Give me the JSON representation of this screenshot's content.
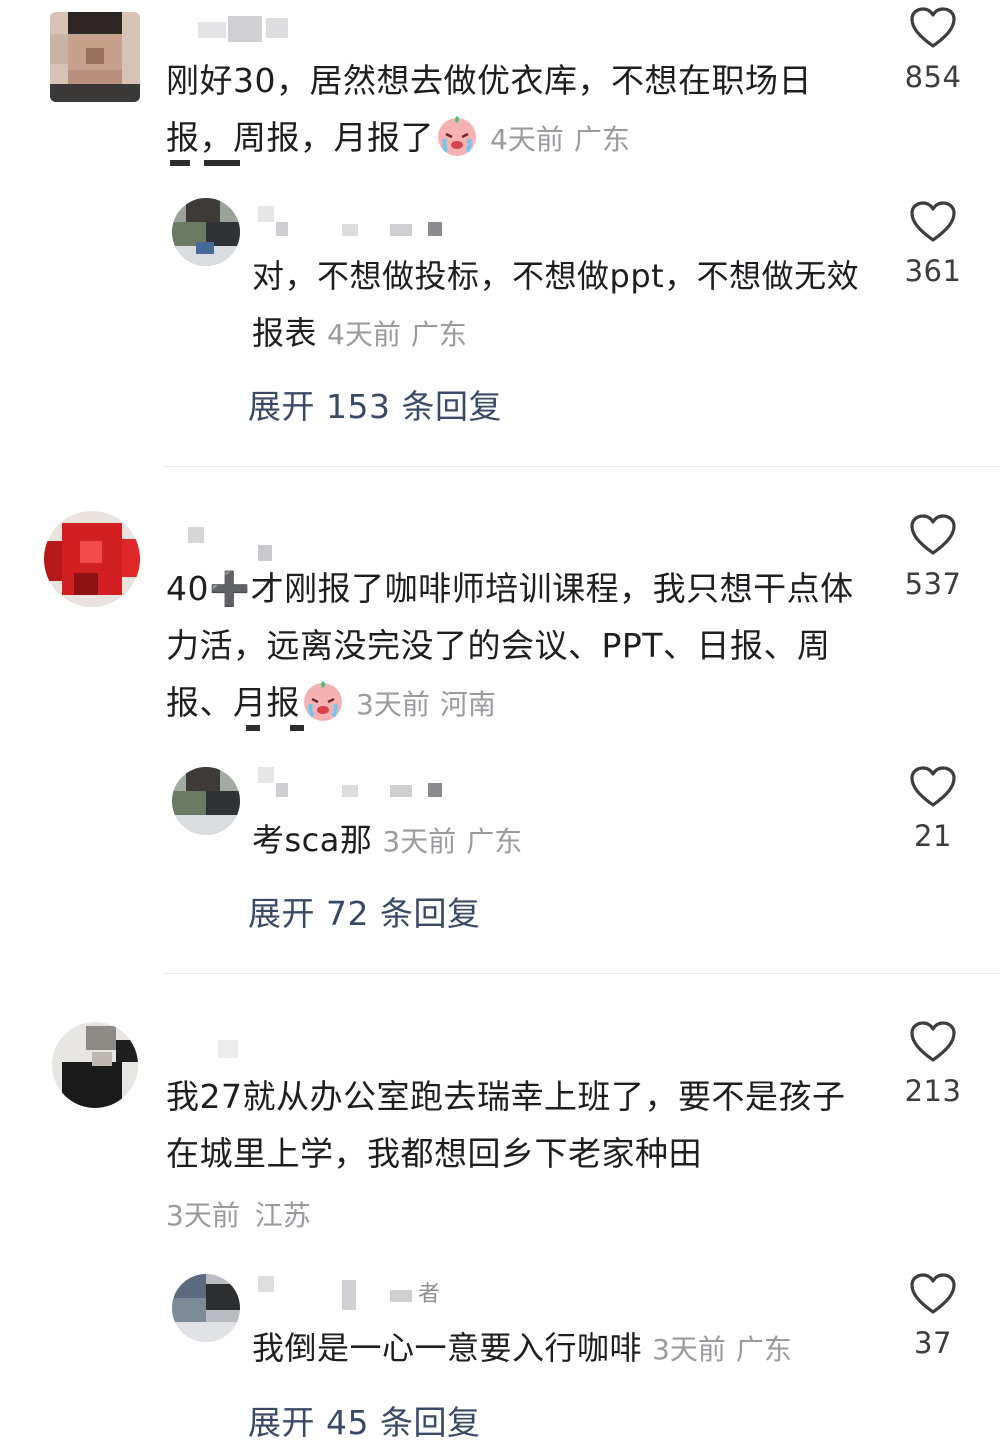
{
  "comments": [
    {
      "text": "刚好30，居然想去做优衣库，不想在职场日报，周报，月报了",
      "time": "4天前",
      "location": "广东",
      "likes": "854",
      "reply": {
        "text": "对，不想做投标，不想做ppt，不想做无效报表",
        "time": "4天前",
        "location": "广东",
        "likes": "361"
      },
      "expand_label": "展开 153 条回复"
    },
    {
      "text": "40➕才刚报了咖啡师培训课程，我只想干点体力活，远离没完没了的会议、PPT、日报、周报、月报",
      "time": "3天前",
      "location": "河南",
      "likes": "537",
      "reply": {
        "text": "考sca那",
        "time": "3天前",
        "location": "广东",
        "likes": "21"
      },
      "expand_label": "展开 72 条回复"
    },
    {
      "text": "我27就从办公室跑去瑞幸上班了，要不是孩子在城里上学，我都想回乡下老家种田",
      "time": "3天前",
      "location": "江苏",
      "likes": "213",
      "reply": {
        "nickname_visible": "者",
        "text": "我倒是一心一意要入行咖啡",
        "time": "3天前",
        "location": "广东",
        "likes": "37"
      },
      "expand_label": "展开 45 条回复"
    }
  ],
  "icons": {
    "like": "heart-outline-icon",
    "emoji": "crying-face-emoji-icon",
    "plus": "heavy-plus-icon"
  },
  "colors": {
    "text": "#1e1e22",
    "meta": "#9a9aa2",
    "expand": "#3a4a66",
    "heart_stroke": "#3c3c42",
    "divider": "#ececef"
  }
}
